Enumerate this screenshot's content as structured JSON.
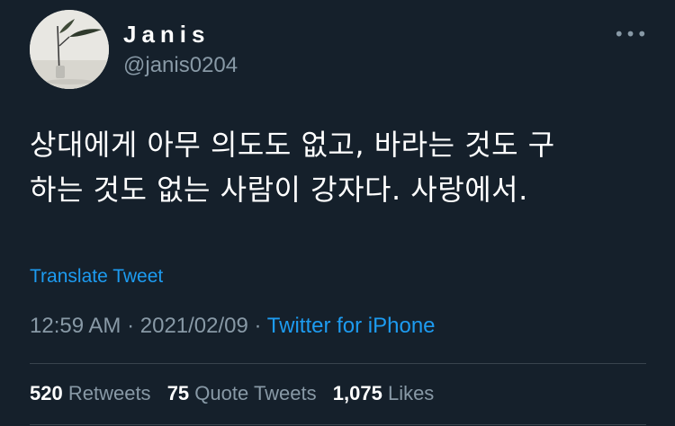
{
  "author": {
    "display_name": "Janis",
    "handle": "@janis0204",
    "avatar_icon": "plant-vase-avatar-icon"
  },
  "menu": {
    "more_icon": "more-options-icon",
    "glyph": "•••"
  },
  "tweet": {
    "text_lines": [
      "상대에게 아무 의도도 없고, 바라는 것도 구",
      "하는 것도 없는 사람이 강자다. 사랑에서."
    ],
    "translate_label": "Translate Tweet",
    "time": "12:59 AM",
    "sep1": "·",
    "date": "2021/02/09",
    "sep2": "·",
    "source": "Twitter for iPhone"
  },
  "stats": {
    "retweets_count": "520",
    "retweets_label": "Retweets",
    "quote_count": "75",
    "quote_label": "Quote Tweets",
    "likes_count": "1,075",
    "likes_label": "Likes"
  },
  "colors": {
    "background": "#15202b",
    "text_primary": "#ffffff",
    "text_secondary": "#8899a6",
    "accent": "#1d9bf0",
    "divider": "#38444d"
  }
}
